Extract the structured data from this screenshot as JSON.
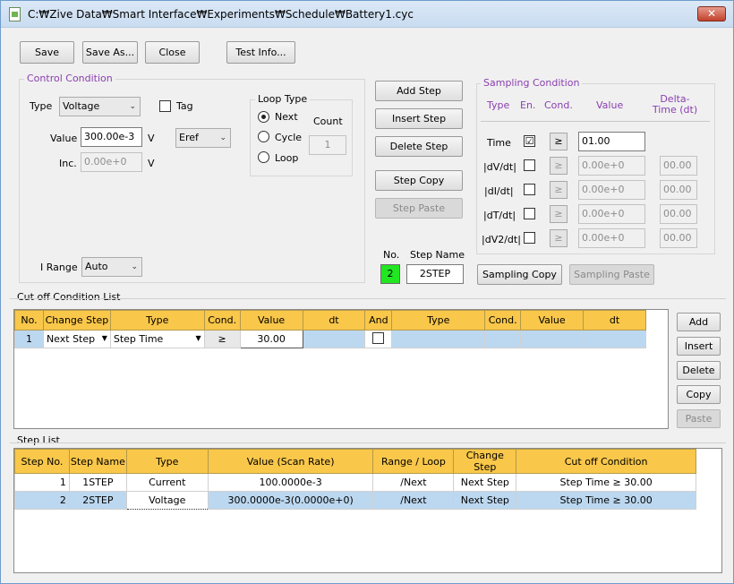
{
  "window": {
    "title": "C:₩Zive Data₩Smart Interface₩Experiments₩Schedule₩Battery1.cyc",
    "close_label": "✕"
  },
  "toolbar": {
    "save": "Save",
    "save_as": "Save As...",
    "close": "Close",
    "test_info": "Test Info..."
  },
  "control": {
    "legend": "Control Condition",
    "type_label": "Type",
    "type_value": "Voltage",
    "tag_label": "Tag",
    "value_label": "Value",
    "value": "300.00e-3",
    "value_unit": "V",
    "ref_value": "Eref",
    "inc_label": "Inc.",
    "inc_value": "0.00e+0",
    "inc_unit": "V",
    "irange_label": "I Range",
    "irange_value": "Auto"
  },
  "loop": {
    "legend": "Loop Type",
    "next": "Next",
    "cycle": "Cycle",
    "loop": "Loop",
    "count_label": "Count",
    "count_value": "1"
  },
  "step_buttons": {
    "add": "Add Step",
    "insert": "Insert Step",
    "delete": "Delete Step",
    "copy": "Step Copy",
    "paste": "Step Paste"
  },
  "step_info": {
    "no_label": "No.",
    "name_label": "Step Name",
    "no_value": "2",
    "name_value": "2STEP"
  },
  "sampling": {
    "legend": "Sampling Condition",
    "headers": {
      "type": "Type",
      "en": "En.",
      "cond": "Cond.",
      "value": "Value",
      "delta": "Delta-Time (dt)"
    },
    "rows": [
      {
        "type": "Time",
        "enabled": "☑",
        "cond": "≥",
        "value": "01.00",
        "dt": ""
      },
      {
        "type": "|dV/dt|",
        "enabled": "",
        "cond": "≥",
        "value": "0.00e+0",
        "dt": "00.00"
      },
      {
        "type": "|dI/dt|",
        "enabled": "",
        "cond": "≥",
        "value": "0.00e+0",
        "dt": "00.00"
      },
      {
        "type": "|dT/dt|",
        "enabled": "",
        "cond": "≥",
        "value": "0.00e+0",
        "dt": "00.00"
      },
      {
        "type": "|dV2/dt|",
        "enabled": "",
        "cond": "≥",
        "value": "0.00e+0",
        "dt": "00.00"
      }
    ],
    "copy": "Sampling Copy",
    "paste": "Sampling Paste"
  },
  "cutoff": {
    "title": "Cut off Condition List",
    "columns": [
      "No.",
      "Change Step",
      "Type",
      "Cond.",
      "Value",
      "dt",
      "And",
      "Type",
      "Cond.",
      "Value",
      "dt"
    ],
    "row": {
      "no": "1",
      "change_step": "Next Step",
      "type": "Step Time",
      "cond": "≥",
      "value": "30.00"
    },
    "buttons": {
      "add": "Add",
      "insert": "Insert",
      "delete": "Delete",
      "copy": "Copy",
      "paste": "Paste"
    }
  },
  "steplist": {
    "title": "Step List",
    "columns": [
      "Step No.",
      "Step Name",
      "Type",
      "Value (Scan Rate)",
      "Range / Loop",
      "Change Step",
      "Cut off Condition"
    ],
    "rows": [
      [
        "1",
        "1STEP",
        "Current",
        "100.0000e-3",
        "/Next",
        "Next Step",
        "Step Time ≥ 30.00"
      ],
      [
        "2",
        "2STEP",
        "Voltage",
        "300.0000e-3(0.0000e+0)",
        "/Next",
        "Next Step",
        "Step Time ≥ 30.00"
      ]
    ]
  },
  "colors": {
    "accent_label": "#8a3fb0",
    "grid_header": "#f9c74a",
    "selected_row": "#bcd8f0",
    "step_no_bg": "#22e622"
  }
}
